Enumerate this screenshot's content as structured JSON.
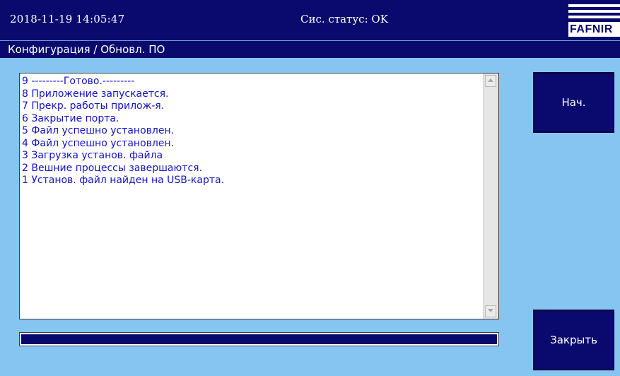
{
  "header": {
    "datetime": "2018-11-19  14:05:47",
    "status": "Сис. статус: OK",
    "logo_text": "FAFNIR"
  },
  "title": "Конфигурация / Обновл. ПО",
  "log": {
    "lines": [
      "9 ---------Готово.---------",
      "8 Приложение запускается.",
      "7 Прекр. работы прилож-я.",
      "6 Закрытие порта.",
      "5 Файл успешно установлен.",
      "4 Файл успешно установлен.",
      "3 Загрузка установ. файла",
      "2 Вешние процессы завершаются.",
      "1 Установ. файл найден на USB-карта."
    ]
  },
  "progress": {
    "fraction": 1.0
  },
  "buttons": {
    "start_label": "Нач.",
    "close_label": "Закрыть"
  },
  "colors": {
    "background": "#86c5f2",
    "bar": "#0a0a6e",
    "log_text": "#1414c8"
  }
}
